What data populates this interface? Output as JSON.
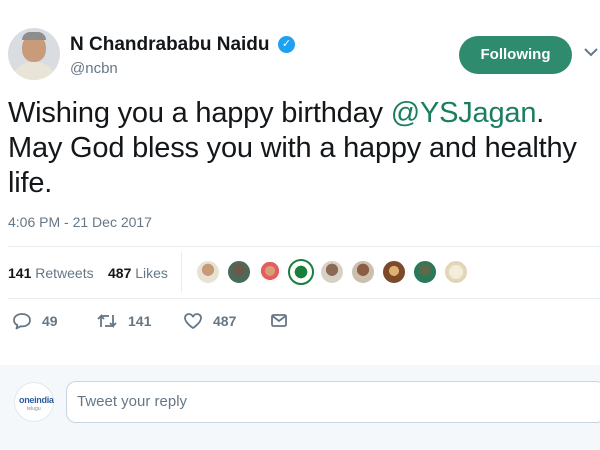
{
  "profile": {
    "display_name": "N Chandrababu Naidu",
    "verified_icon": "verified-badge-icon",
    "handle": "@ncbn"
  },
  "follow_button": {
    "label": "Following"
  },
  "tweet": {
    "text_before": "Wishing you a happy birthday ",
    "mention": "@YSJagan",
    "text_after": ".\nMay God bless you with a happy and healthy life.",
    "timestamp": "4:06 PM - 21 Dec 2017"
  },
  "stats": {
    "retweets_count": "141",
    "retweets_label": "Retweets",
    "likes_count": "487",
    "likes_label": "Likes"
  },
  "actions": {
    "reply_count": "49",
    "retweet_count": "141",
    "like_count": "487"
  },
  "reply_box": {
    "avatar_logo": "oneindia",
    "avatar_sub": "telugu",
    "placeholder": "Tweet your reply"
  },
  "colors": {
    "accent": "#2e8b6e",
    "mention": "#1a7f60",
    "muted": "#657786",
    "verified": "#1da1f2"
  }
}
